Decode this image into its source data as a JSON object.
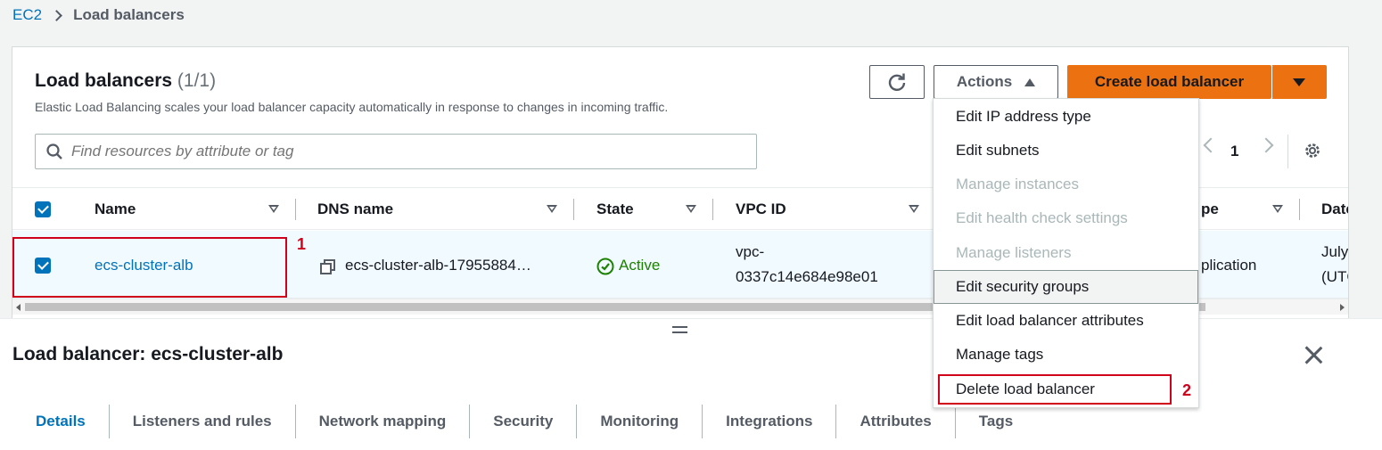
{
  "breadcrumb": {
    "root": "EC2",
    "current": "Load balancers"
  },
  "list": {
    "title": "Load balancers",
    "count": "(1/1)",
    "description": "Elastic Load Balancing scales your load balancer capacity automatically in response to changes in incoming traffic.",
    "refresh_icon": "refresh-icon",
    "actions_label": "Actions",
    "create_label": "Create load balancer",
    "search_placeholder": "Find resources by attribute or tag",
    "page": "1",
    "columns": [
      "Name",
      "DNS name",
      "State",
      "VPC ID",
      "pe",
      "Date"
    ],
    "row": {
      "name": "ecs-cluster-alb",
      "dns": "ecs-cluster-alb-17955884…",
      "state": "Active",
      "vpc_line1": "vpc-",
      "vpc_line2": "0337c14e684e98e01",
      "type": "plication",
      "date_line1": "July",
      "date_line2": "(UTC"
    }
  },
  "actions_menu": [
    {
      "label": "Edit IP address type",
      "enabled": true
    },
    {
      "label": "Edit subnets",
      "enabled": true
    },
    {
      "label": "Manage instances",
      "enabled": false
    },
    {
      "label": "Edit health check settings",
      "enabled": false
    },
    {
      "label": "Manage listeners",
      "enabled": false
    },
    {
      "label": "Edit security groups",
      "enabled": true
    },
    {
      "label": "Edit load balancer attributes",
      "enabled": true
    },
    {
      "label": "Manage tags",
      "enabled": true
    },
    {
      "label": "Delete load balancer",
      "enabled": true
    }
  ],
  "details": {
    "title": "Load balancer: ecs-cluster-alb",
    "tabs": [
      "Details",
      "Listeners and rules",
      "Network mapping",
      "Security",
      "Monitoring",
      "Integrations",
      "Attributes",
      "Tags"
    ]
  },
  "annotations": {
    "step1": "1",
    "step2": "2"
  },
  "colors": {
    "link": "#0073bb",
    "primary": "#ec7211",
    "success": "#1d8102",
    "annotation": "#d0021b"
  }
}
